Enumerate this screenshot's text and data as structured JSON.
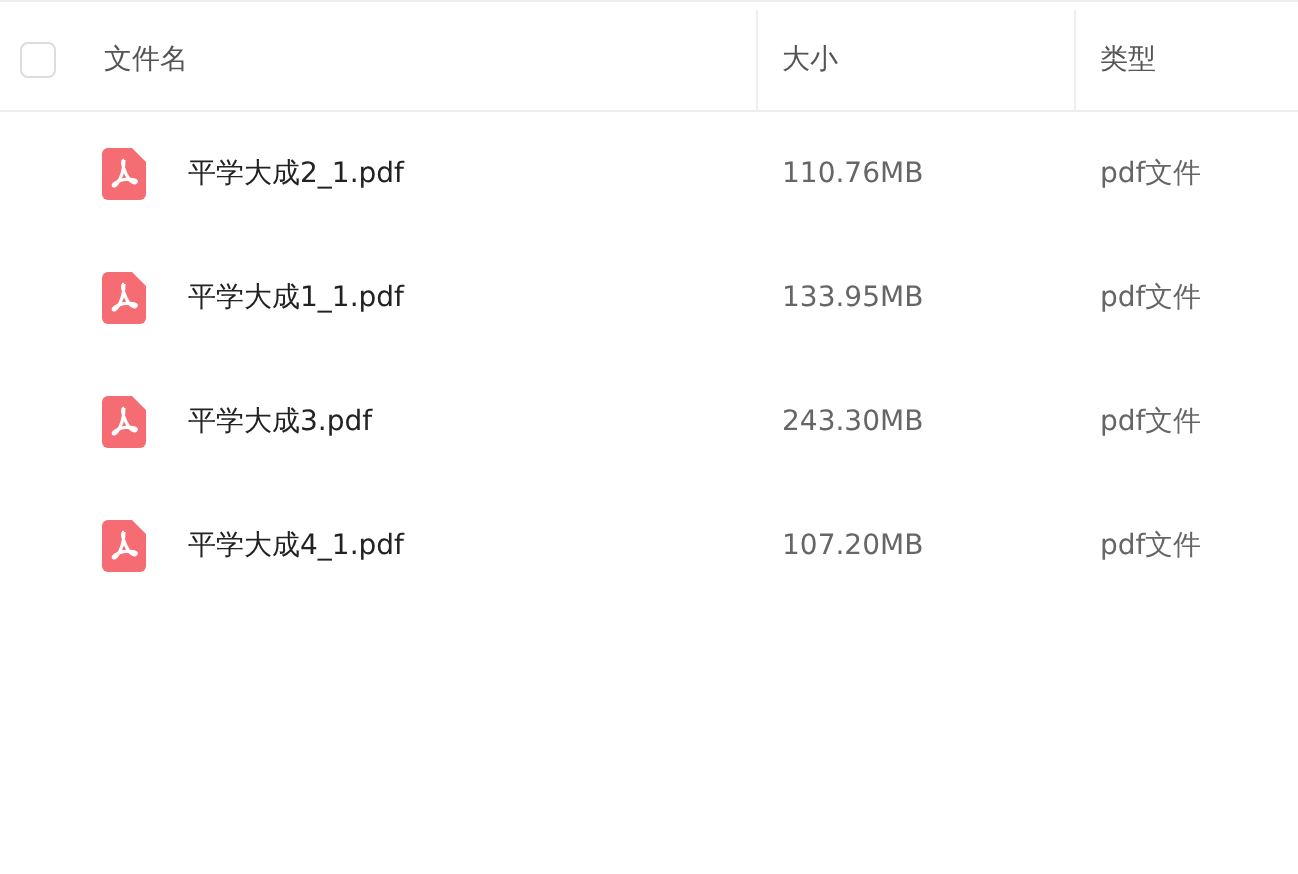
{
  "table": {
    "select_all": {
      "checked": false
    },
    "columns": [
      "文件名",
      "大小",
      "类型"
    ],
    "rows": [
      {
        "name": "平学大成2_1.pdf",
        "size": "110.76MB",
        "type": "pdf文件"
      },
      {
        "name": "平学大成1_1.pdf",
        "size": "133.95MB",
        "type": "pdf文件"
      },
      {
        "name": "平学大成3.pdf",
        "size": "243.30MB",
        "type": "pdf文件"
      },
      {
        "name": "平学大成4_1.pdf",
        "size": "107.20MB",
        "type": "pdf文件"
      }
    ]
  }
}
